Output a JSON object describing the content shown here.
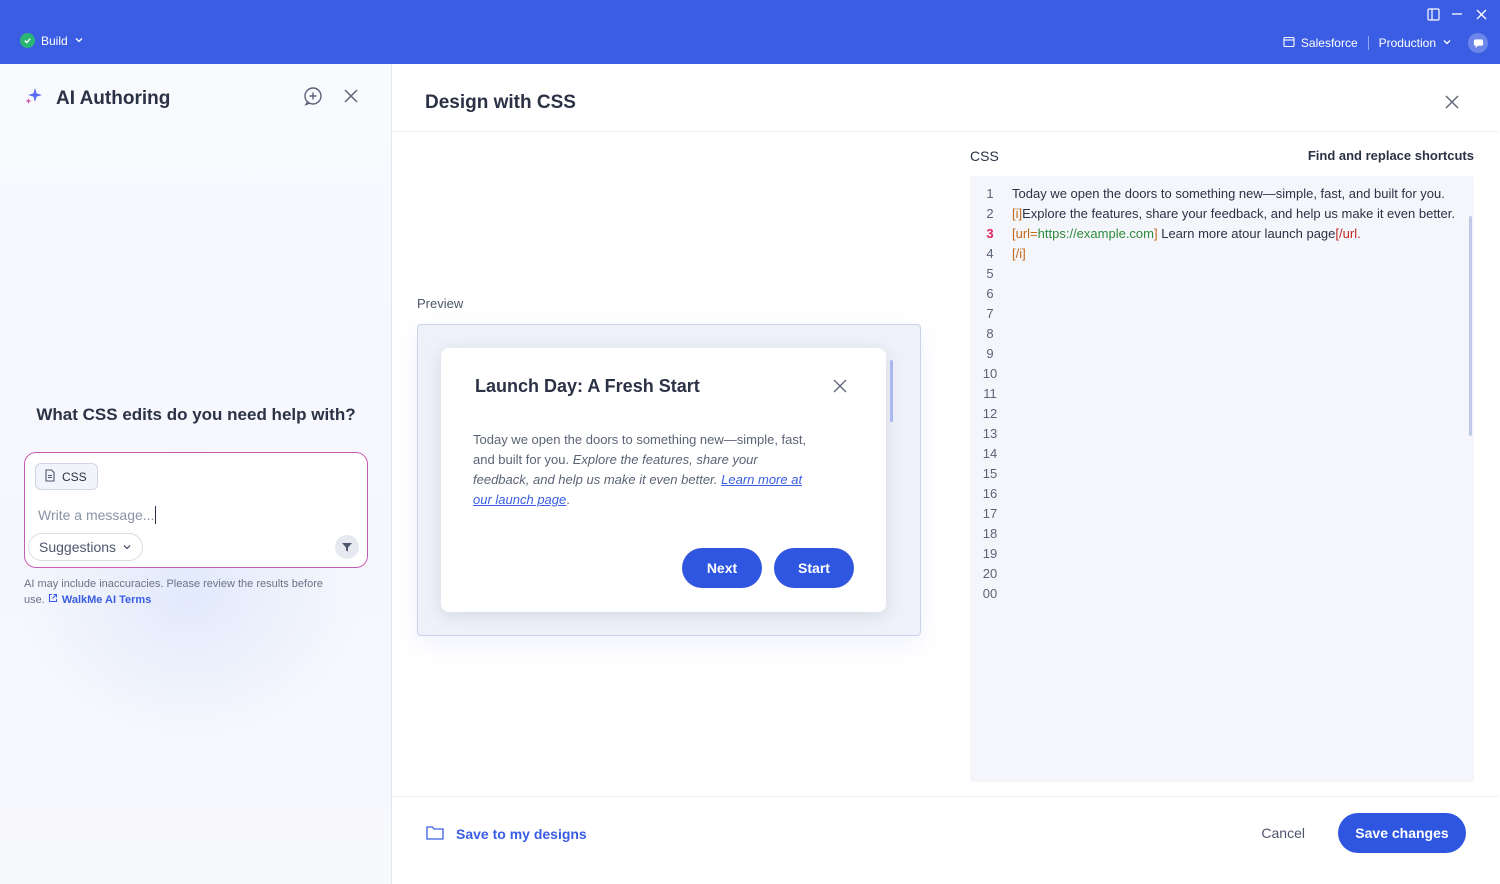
{
  "titlebar": {
    "build_label": "Build",
    "env_system": "Salesforce",
    "env_name": "Production"
  },
  "ai_panel": {
    "title": "AI Authoring",
    "question": "What CSS edits do you need help with?",
    "chip_label": "CSS",
    "message_placeholder": "Write a message...",
    "suggestions_label": "Suggestions",
    "disclaimer": "AI may include inaccuracies. Please review the results before use.",
    "terms_link": "WalkMe AI Terms"
  },
  "dialog": {
    "title": "Design with CSS",
    "preview_label": "Preview",
    "css_label": "CSS",
    "find_replace": "Find and replace shortcuts",
    "save_to_designs": "Save to my designs",
    "cancel": "Cancel",
    "save_changes": "Save changes"
  },
  "preview_card": {
    "title": "Launch Day: A Fresh Start",
    "body_plain": "Today we open the doors to something new—simple, fast, and built for you.",
    "body_italic": "Explore the features, share your feedback, and help us make it even better.",
    "body_link": "Learn more at our launch page",
    "body_end": ".",
    "next_label": "Next",
    "start_label": "Start"
  },
  "editor": {
    "line_numbers": [
      "1",
      "2",
      "3",
      "4",
      "5",
      "6",
      "7",
      "8",
      "9",
      "10",
      "11",
      "12",
      "13",
      "14",
      "15",
      "16",
      "17",
      "18",
      "19",
      "20",
      "00"
    ],
    "active_line": "3",
    "code_part1": "Today we open the doors to something new—simple, fast, and built for you. ",
    "tag_i_open": "[i]",
    "code_part2": "Explore the features, share your feedback, and help us make it even better.  ",
    "url_open_bracket": "[url=",
    "url_value": "https://example.com",
    "url_close_bracket": "]",
    "code_part3": " Learn more atour launch page",
    "url_close": "[/url.",
    "tag_i_close": "[/i]"
  },
  "colors": {
    "accent": "#3a5de3",
    "button": "#2f56e0",
    "composer_border": "#c85bb3",
    "active_line": "#e0245e"
  },
  "icons": [
    "check-icon",
    "chevron-down-icon",
    "sidebar-layout-icon",
    "minimize-icon",
    "close-icon",
    "window-icon",
    "chat-bubble-icon",
    "sparkle-icon",
    "new-chat-icon",
    "document-icon",
    "filter-send-icon",
    "external-link-icon",
    "folder-icon"
  ]
}
